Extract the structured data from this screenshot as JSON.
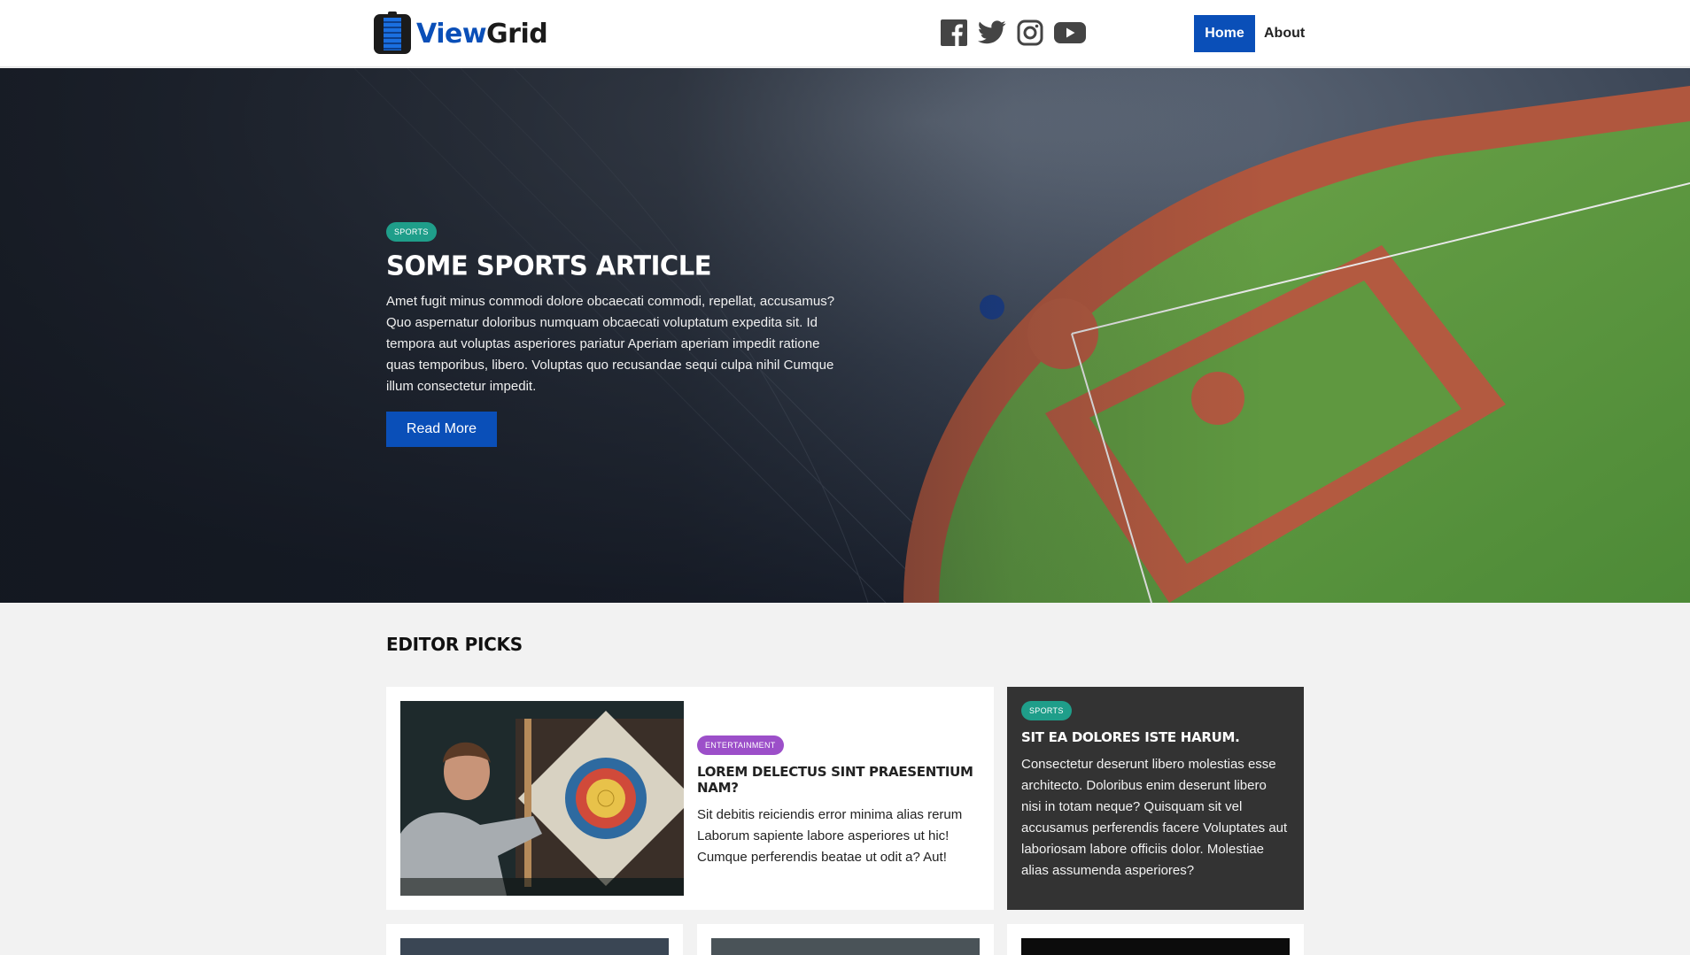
{
  "header": {
    "logo": {
      "part1": "View",
      "part2": "Grid"
    },
    "social": [
      "facebook-icon",
      "twitter-icon",
      "instagram-icon",
      "youtube-icon"
    ],
    "nav": {
      "home": "Home",
      "about": "About"
    }
  },
  "hero": {
    "badge": "SPORTS",
    "title": "SOME SPORTS ARTICLE",
    "text": "Amet fugit minus commodi dolore obcaecati commodi, repellat, accusamus? Quo aspernatur doloribus numquam obcaecati voluptatum expedita sit. Id tempora aut voluptas asperiores pariatur Aperiam aperiam impedit ratione quas temporibus, libero. Voluptas quo recusandae sequi culpa nihil Cumque illum consectetur impedit.",
    "button": "Read More"
  },
  "editor_picks": {
    "title": "EDITOR PICKS",
    "main_card": {
      "badge": "ENTERTAINMENT",
      "title": "LOREM DELECTUS SINT PRAESENTIUM NAM?",
      "text": "Sit debitis reiciendis error minima alias rerum Laborum sapiente labore asperiores ut hic! Cumque perferendis beatae ut odit a? Aut!"
    },
    "side_card": {
      "badge": "SPORTS",
      "title": "SIT EA DOLORES ISTE HARUM.",
      "text": "Consectetur deserunt libero molestias esse architecto. Doloribus enim deserunt libero nisi in totam neque? Quisquam sit vel accusamus perferendis facere Voluptates aut laboriosam labore officiis dolor. Molestiae alias assumenda asperiores?"
    }
  },
  "colors": {
    "brand": "#0a4fb8",
    "sports": "#1f9e8a",
    "entertainment": "#9c4fc9",
    "dark_card": "#333333"
  }
}
